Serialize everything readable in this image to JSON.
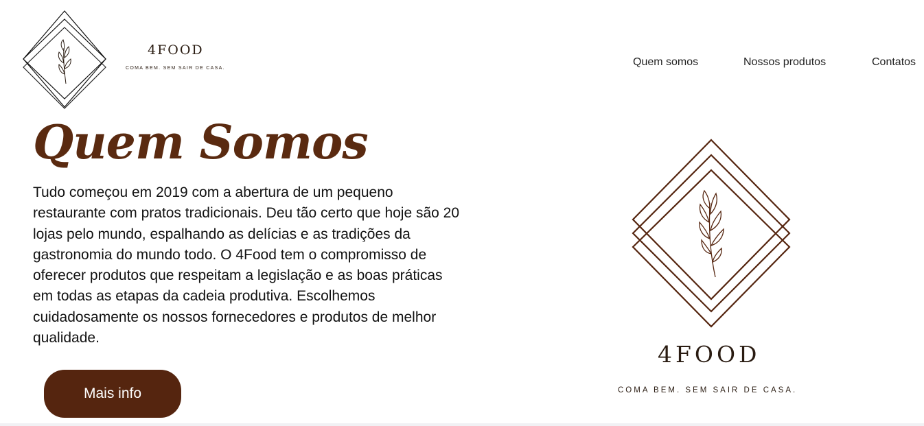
{
  "brand": {
    "name": "4FOOD",
    "tagline": "COMA BEM. SEM SAIR DE CASA."
  },
  "nav": {
    "items": [
      {
        "label": "Quem somos"
      },
      {
        "label": "Nossos produtos"
      },
      {
        "label": "Contatos"
      }
    ]
  },
  "main": {
    "title": "Quem Somos",
    "body": "Tudo começou em 2019 com a abertura de um pequeno restaurante com pratos tradicionais. Deu tão certo que hoje são 20 lojas pelo mundo, espalhando as delícias e as tradições da gastronomia do mundo todo. O 4Food tem o compromisso de oferecer produtos que respeitam a legislação e as boas práticas em todas as etapas da cadeia produtiva. Escolhemos cuidadosamente os nossos fornecedores e produtos de melhor qualidade.",
    "button_label": "Mais info"
  },
  "hero": {
    "name": "4FOOD",
    "tagline": "COMA BEM. SEM SAIR DE CASA."
  },
  "colors": {
    "accent": "#55250f",
    "title": "#5a2a10",
    "logo_stroke": "#2a1c12"
  },
  "icons": {
    "logo": "leaf-diamond-logo-icon"
  }
}
